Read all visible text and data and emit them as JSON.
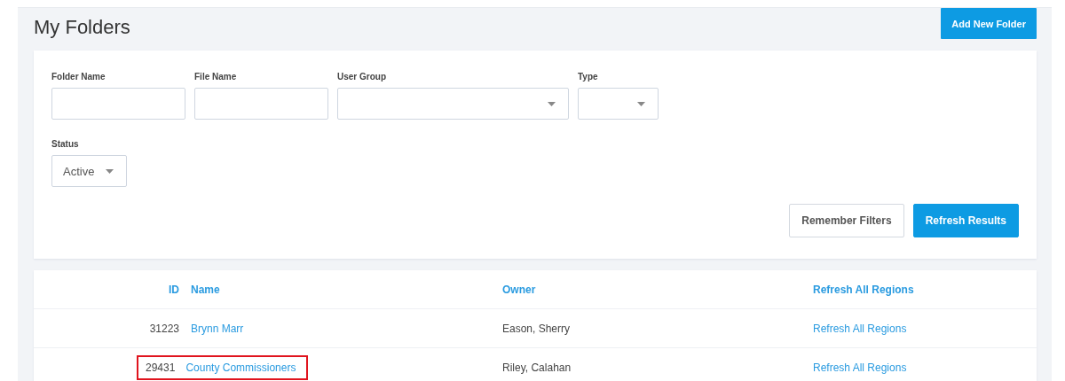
{
  "page": {
    "title": "My Folders",
    "add_button": "Add New Folder"
  },
  "filters": {
    "fields": [
      {
        "kind": "text",
        "label": "Folder Name"
      },
      {
        "kind": "text",
        "label": "File Name"
      },
      {
        "kind": "select",
        "label": "User Group"
      },
      {
        "kind": "select",
        "label": "Type"
      },
      {
        "kind": "select",
        "label": "Status",
        "value": "Active"
      }
    ],
    "buttons": [
      {
        "kind": "secondary",
        "label": "Remember Filters"
      },
      {
        "kind": "primary",
        "label": "Refresh Results"
      }
    ]
  },
  "table": {
    "columns": [
      "ID",
      "Name",
      "Owner",
      "Refresh All Regions"
    ],
    "rows": [
      {
        "id": "31223",
        "name": "Brynn Marr",
        "owner": "Eason, Sherry",
        "action": "Refresh All Regions",
        "highlighted": false
      },
      {
        "id": "29431",
        "name": "County Commissioners",
        "owner": "Riley, Calahan",
        "action": "Refresh All Regions",
        "highlighted": true
      }
    ]
  }
}
